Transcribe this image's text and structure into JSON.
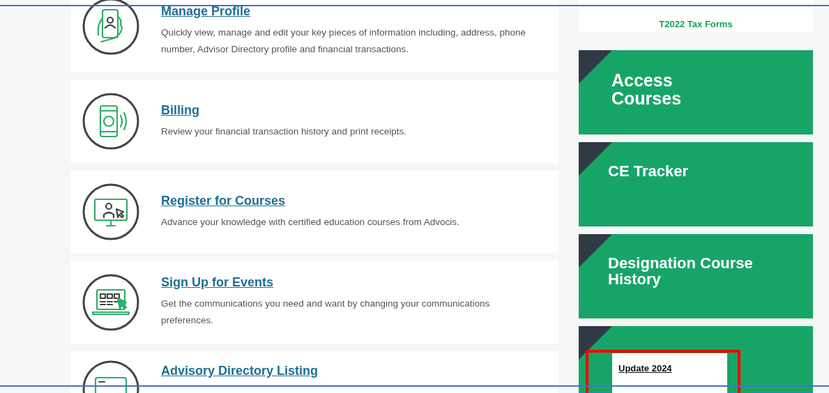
{
  "services": [
    {
      "kind": "phone",
      "title": "Manage Profile",
      "description": "Quickly view, manage and edit your key pieces of information including, address, phone number, Advisor Directory profile and financial transactions."
    },
    {
      "kind": "payment",
      "title": "Billing",
      "description": "Review your financial transaction history and print receipts."
    },
    {
      "kind": "monitor",
      "title": "Register for Courses",
      "description": "Advance your knowledge with certified education courses from Advocis."
    },
    {
      "kind": "laptop",
      "title": "Sign Up for Events",
      "description": "Get the communications you need and want by changing your communications preferences."
    },
    {
      "kind": "card",
      "title": "Advisory Directory Listing"
    }
  ],
  "sidebar": {
    "tax_forms_link": "T2022 Tax Forms",
    "tiles": [
      {
        "title_lines": [
          "Access",
          "Courses"
        ]
      },
      {
        "title_lines": [
          "CE Tracker"
        ]
      },
      {
        "title_lines": [
          "Designation Course",
          "History"
        ]
      }
    ]
  },
  "callout": {
    "label": "Update 2024"
  }
}
